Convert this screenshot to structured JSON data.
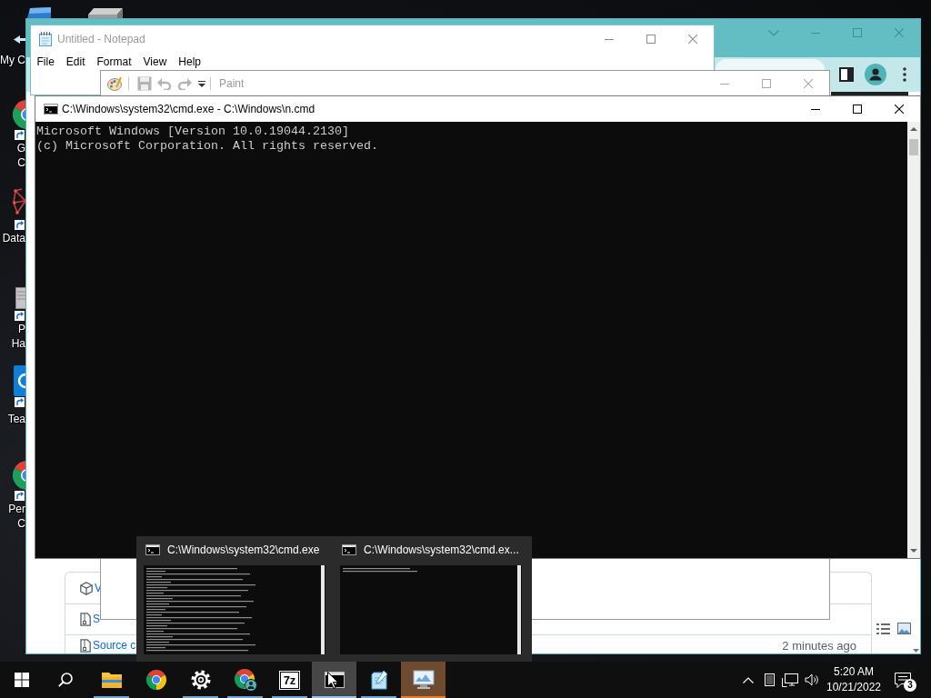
{
  "desktop": {
    "icons": [
      {
        "kind": "computer",
        "label": [
          "My C"
        ]
      },
      {
        "kind": "drive"
      },
      {
        "kind": "wheel",
        "label": [
          "G",
          "C"
        ]
      },
      {
        "kind": "network",
        "label": [
          "Data"
        ]
      },
      {
        "kind": "server",
        "label": [
          "P",
          "Ha"
        ]
      },
      {
        "kind": "remote",
        "label": [
          "Tea"
        ]
      },
      {
        "kind": "wheel",
        "label": [
          "Per",
          "C"
        ]
      }
    ]
  },
  "browser_window": {
    "files": [
      {
        "kind": "package",
        "name": "V"
      },
      {
        "kind": "archive",
        "name": "S"
      },
      {
        "kind": "archive",
        "name": "Source c",
        "date": "2 minutes ago"
      }
    ]
  },
  "notepad_window": {
    "title": "Untitled - Notepad",
    "active": false,
    "menu": [
      "File",
      "Edit",
      "Format",
      "View",
      "Help"
    ]
  },
  "paint_window": {
    "title": "Paint",
    "active": false
  },
  "console_window": {
    "title": "C:\\Windows\\system32\\cmd.exe - C:\\Windows\\n.cmd",
    "active": true,
    "lines": [
      "Microsoft Windows [Version 10.0.19044.2130]",
      "(c) Microsoft Corporation. All rights reserved."
    ]
  },
  "taskbar_preview": {
    "items": [
      {
        "title": "C:\\Windows\\system32\\cmd.exe",
        "kind": "long_output"
      },
      {
        "title": "C:\\Windows\\system32\\cmd.ex...",
        "kind": "short_output"
      }
    ]
  },
  "taskbar": {
    "apps": [
      {
        "kind": "explorer",
        "running": true,
        "selected": false,
        "attention": false
      },
      {
        "kind": "wheel",
        "running": false,
        "selected": false,
        "attention": false
      },
      {
        "kind": "settings",
        "running": true,
        "selected": false,
        "attention": false
      },
      {
        "kind": "wheel_profile",
        "running": true,
        "selected": false,
        "attention": false
      },
      {
        "kind": "archiver",
        "logo": "7z",
        "running": true,
        "selected": false,
        "attention": false
      },
      {
        "kind": "console",
        "running": true,
        "selected": true,
        "attention": false
      },
      {
        "kind": "notepad",
        "running": true,
        "selected": false,
        "attention": false
      },
      {
        "kind": "paint",
        "running": true,
        "selected": false,
        "attention": true
      }
    ],
    "tray": {
      "time": "5:20 AM",
      "date": "10/21/2022",
      "notification_count": "3"
    }
  }
}
